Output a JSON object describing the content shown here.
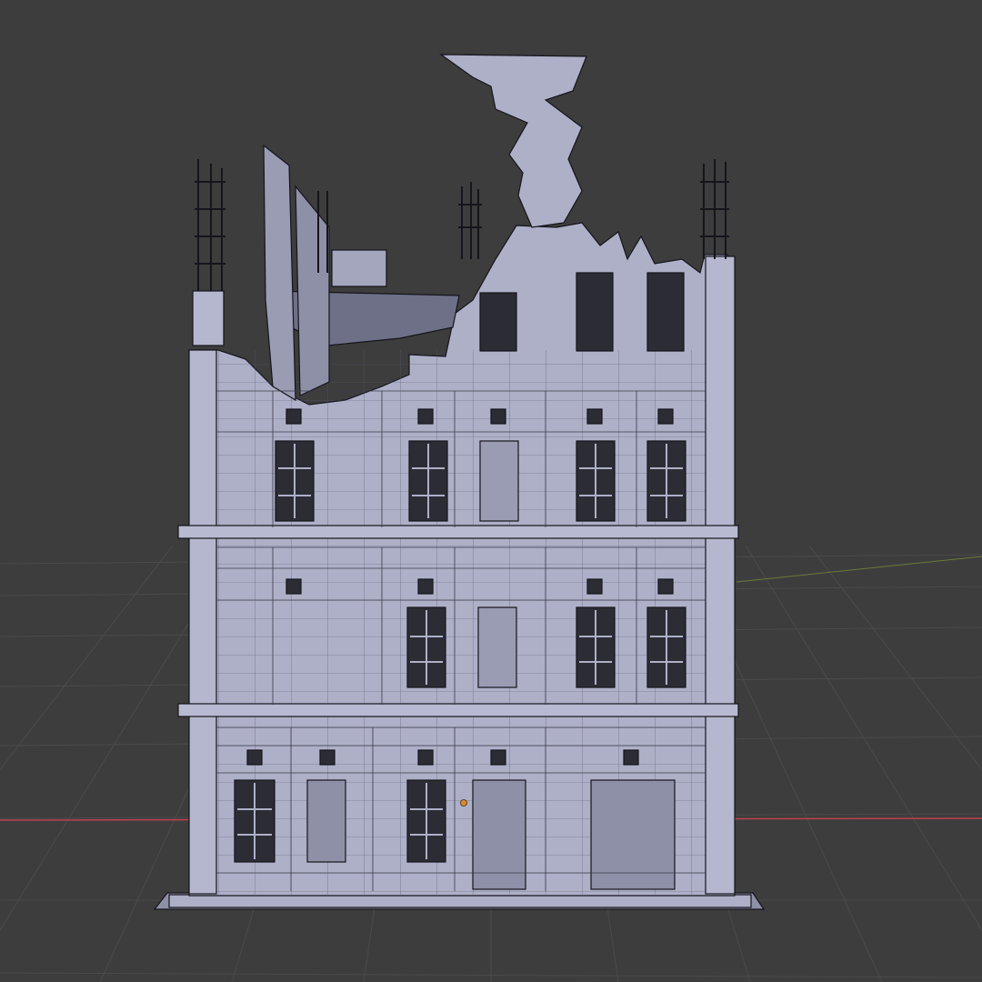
{
  "viewport": {
    "background_color": "#3d3d3d",
    "grid_color": "#4a4a4a",
    "x_axis_color": "#c0404a",
    "y_axis_color": "#6a7a3a",
    "origin_marker_color": "#e08a2a"
  },
  "model": {
    "fill_color": "#aeb0c8",
    "wire_color": "#15151c",
    "window_color": "#2c2c34",
    "shadow_fill_color": "#8e90a8",
    "icons": {
      "origin": "origin-dot-icon"
    }
  }
}
